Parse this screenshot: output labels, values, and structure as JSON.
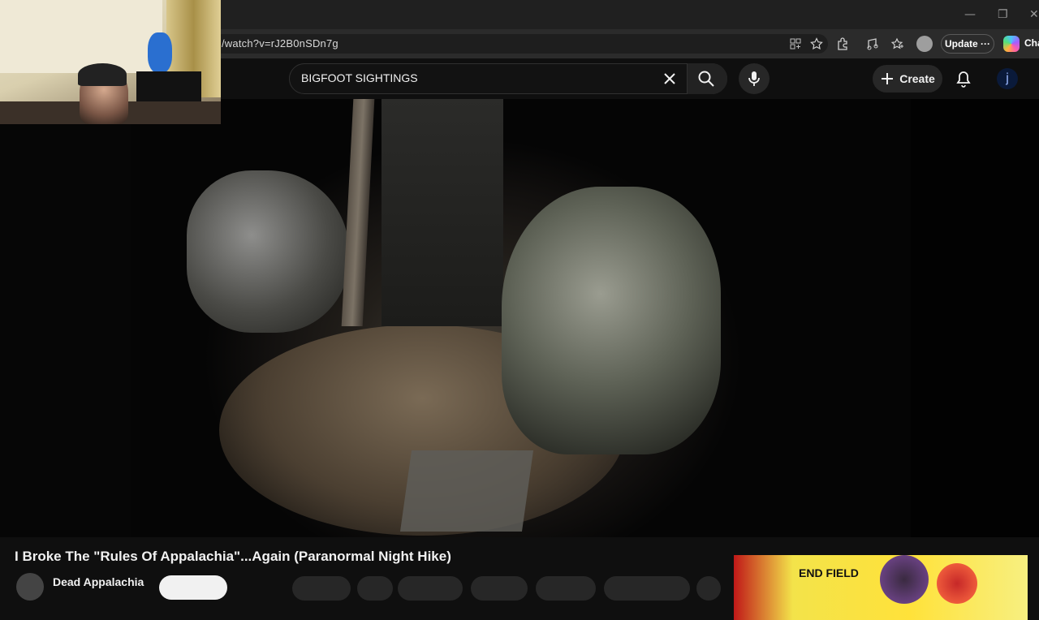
{
  "browser": {
    "url": "/watch?v=rJ2B0nSDn7g",
    "update_label": "Update ···",
    "copilot_label": "Cha",
    "window_controls": [
      "—",
      "❐",
      "✕"
    ]
  },
  "header": {
    "search_query": "BIGFOOT SIGHTINGS",
    "create_label": "Create",
    "avatar_initial": "j"
  },
  "video": {
    "title": "I Broke The \"Rules Of Appalachia\"...Again (Paranormal Night Hike)",
    "channel_name": "Dead Appalachia"
  },
  "ad": {
    "text": "END FIELD"
  },
  "colors": {
    "background": "#0f0f0f",
    "browser_chrome": "#202020",
    "pill": "#272727"
  }
}
